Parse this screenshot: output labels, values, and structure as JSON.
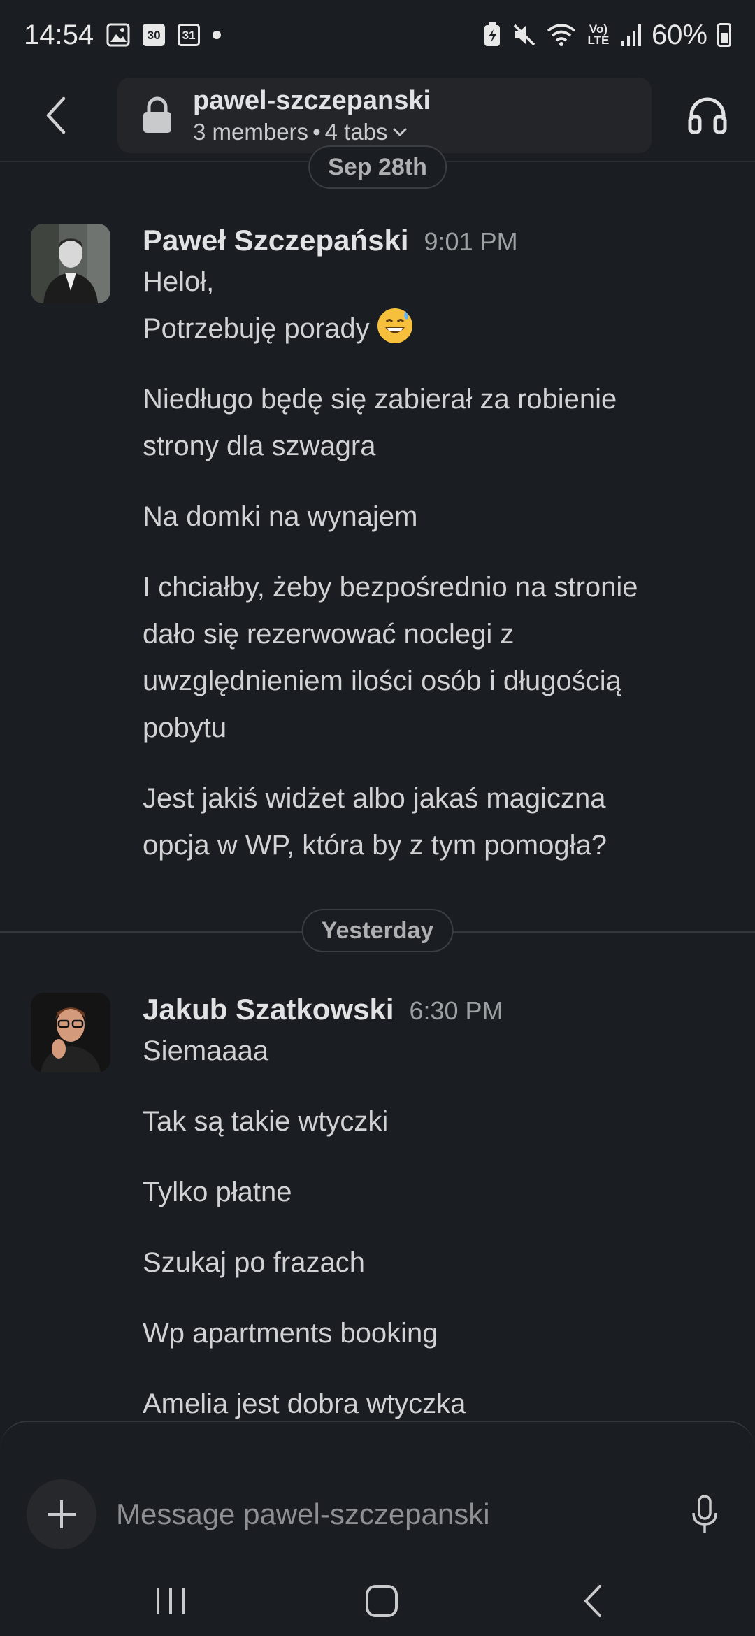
{
  "status_bar": {
    "time": "14:54",
    "calendar_a": "30",
    "calendar_b": "31",
    "battery": "60%",
    "network": "Vo) LTE"
  },
  "header": {
    "channel_name": "pawel-szczepanski",
    "members": "3 members",
    "separator": "•",
    "tabs": "4 tabs"
  },
  "dates": {
    "first": "Sep 28th",
    "second": "Yesterday"
  },
  "messages": [
    {
      "author": "Paweł Szczepański",
      "time": "9:01 PM",
      "lines": {
        "l1": "Heloł,",
        "l2": "Potrzebuję porady",
        "p2a": "Niedługo będę się zabierał za robienie",
        "p2b": "strony dla szwagra",
        "p3": "Na domki na wynajem",
        "p4a": "I chciałby, żeby bezpośrednio na stronie",
        "p4b": "dało się rezerwować noclegi z",
        "p4c": "uwzględnieniem ilości osób i długością",
        "p4d": "pobytu",
        "p5a": "Jest jakiś widżet albo jakaś magiczna",
        "p5b": "opcja w WP, która by z tym pomogła?"
      },
      "emoji": "grinning-face-with-sweat-icon"
    },
    {
      "author": "Jakub Szatkowski",
      "time": "6:30 PM",
      "lines": {
        "p1": "Siemaaaa",
        "p2": "Tak są takie wtyczki",
        "p3": "Tylko płatne",
        "p4": "Szukaj po frazach",
        "p5": "Wp apartments booking",
        "p6": "Amelia jest dobra wtyczka"
      }
    }
  ],
  "composer": {
    "placeholder": "Message pawel-szczepanski"
  },
  "colors": {
    "background": "#1a1d21",
    "surface": "#232529",
    "text": "#d1d2d3",
    "muted": "#9da0a3"
  }
}
